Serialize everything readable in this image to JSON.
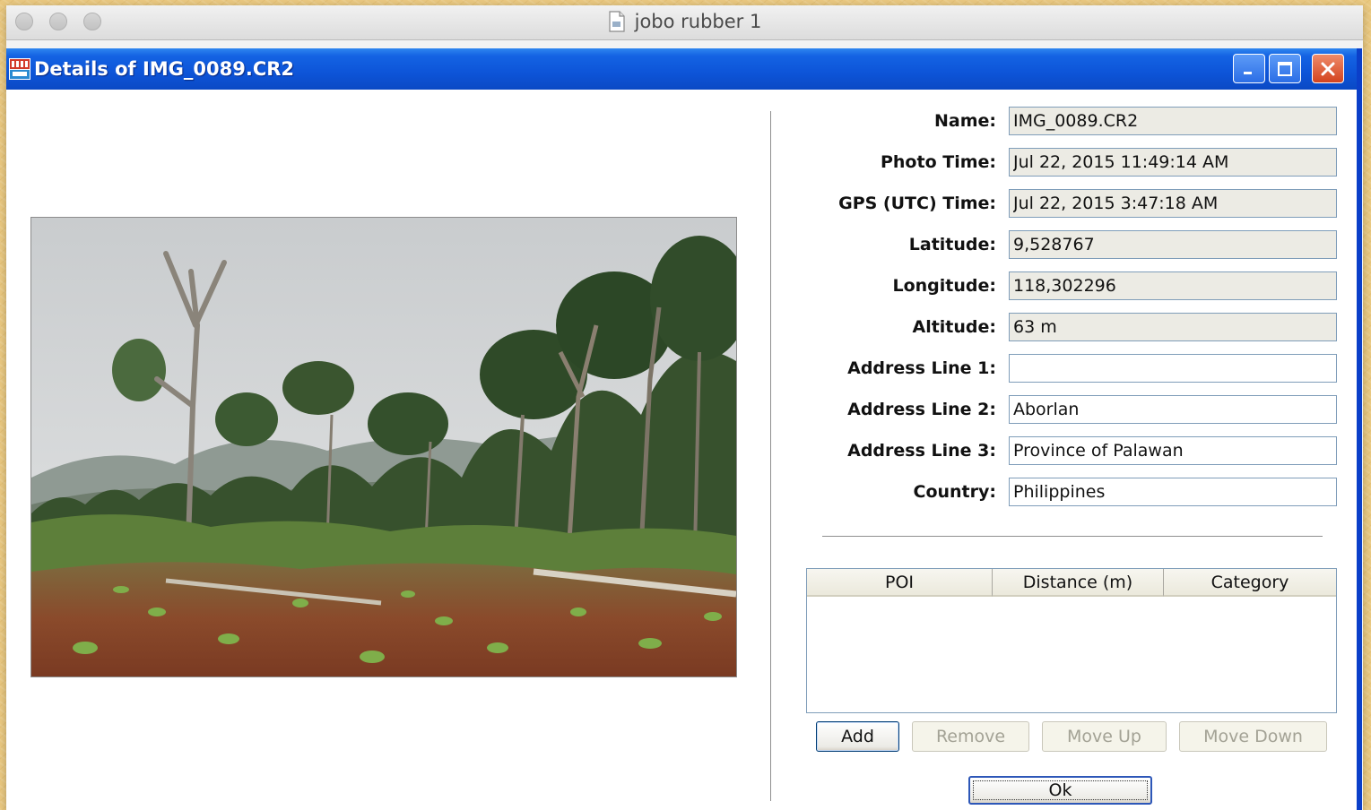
{
  "mac_window": {
    "title": "jobo rubber 1",
    "title_icon": "document-icon"
  },
  "dialog": {
    "title": "Details of IMG_0089.CR2",
    "app_icon": "jobo-app-icon",
    "title_bar_color": "#0d54d8",
    "controls": {
      "minimize": "minimize-icon",
      "maximize": "maximize-icon",
      "close": "close-icon"
    }
  },
  "fields": [
    {
      "label": "Name:",
      "value": "IMG_0089.CR2",
      "readonly": true
    },
    {
      "label": "Photo Time:",
      "value": "Jul 22, 2015 11:49:14 AM",
      "readonly": true
    },
    {
      "label": "GPS (UTC) Time:",
      "value": "Jul 22, 2015 3:47:18 AM",
      "readonly": true
    },
    {
      "label": "Latitude:",
      "value": "9,528767",
      "readonly": true
    },
    {
      "label": "Longitude:",
      "value": "118,302296",
      "readonly": true
    },
    {
      "label": "Altitude:",
      "value": "63 m",
      "readonly": true
    },
    {
      "label": "Address Line 1:",
      "value": "",
      "readonly": false
    },
    {
      "label": "Address Line 2:",
      "value": "Aborlan",
      "readonly": false
    },
    {
      "label": "Address Line 3:",
      "value": "Province of Palawan",
      "readonly": false
    },
    {
      "label": "Country:",
      "value": "Philippines",
      "readonly": false
    }
  ],
  "poi_table": {
    "columns": [
      "POI",
      "Distance (m)",
      "Category"
    ],
    "rows": []
  },
  "buttons": {
    "add": "Add",
    "remove": "Remove",
    "move_up": "Move Up",
    "move_down": "Move Down",
    "ok": "Ok"
  }
}
